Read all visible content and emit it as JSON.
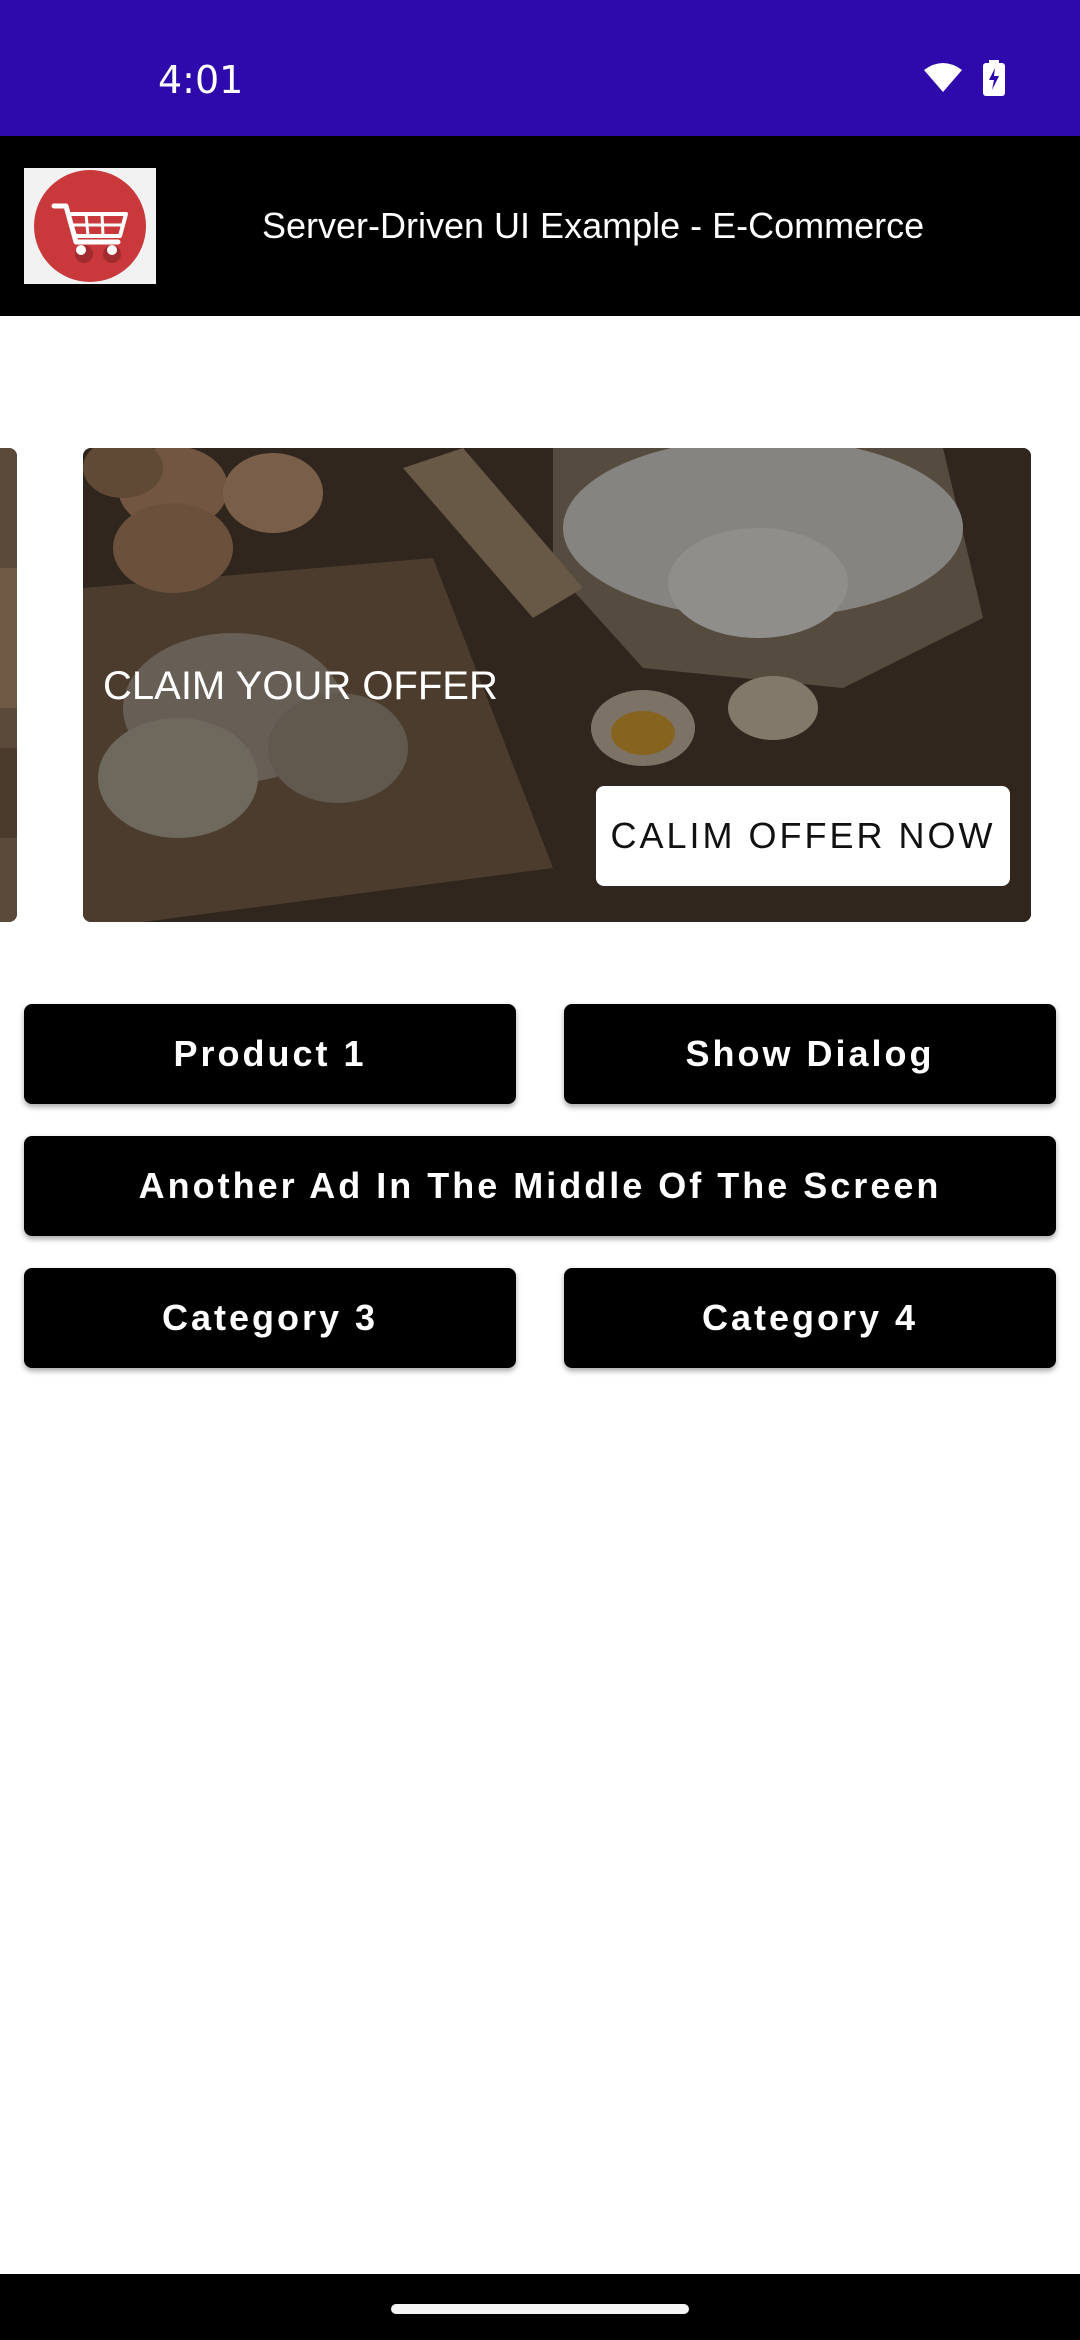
{
  "status_bar": {
    "time": "4:01",
    "background": "#2e09ab",
    "icons": [
      "wifi-icon",
      "battery-charging-icon"
    ]
  },
  "app_bar": {
    "logo_icon": "shopping-cart-icon",
    "title": "Server-Driven UI Example - E-Commerce",
    "background": "#000000"
  },
  "banner": {
    "headline": "CLAIM YOUR OFFER",
    "cta_label": "CALIM OFFER NOW"
  },
  "buttons": {
    "product_1": "Product 1",
    "show_dialog": "Show Dialog",
    "middle_ad": "Another Ad In The Middle Of The Screen",
    "category_3": "Category 3",
    "category_4": "Category 4"
  },
  "colors": {
    "button_bg": "#000000",
    "button_text": "#ffffff",
    "logo_red": "#c9393b"
  }
}
